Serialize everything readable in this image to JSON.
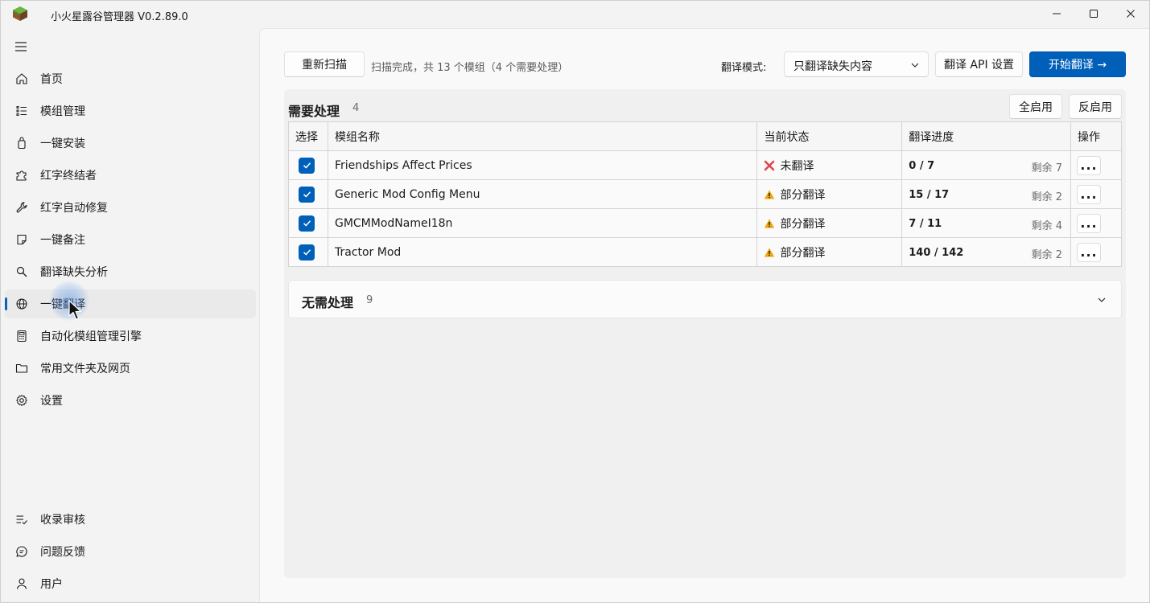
{
  "app": {
    "title": "小火星露谷管理器 V0.2.89.0"
  },
  "sidebar": {
    "items": [
      {
        "label": "首页",
        "icon": "home-icon"
      },
      {
        "label": "模组管理",
        "icon": "list-icon"
      },
      {
        "label": "一键安装",
        "icon": "package-icon"
      },
      {
        "label": "红字终结者",
        "icon": "puzzle-icon"
      },
      {
        "label": "红字自动修复",
        "icon": "wrench-icon"
      },
      {
        "label": "一键备注",
        "icon": "note-icon"
      },
      {
        "label": "翻译缺失分析",
        "icon": "search-icon"
      },
      {
        "label": "一键翻译",
        "icon": "globe-icon",
        "active": true
      },
      {
        "label": "自动化模组管理引擎",
        "icon": "calculator-icon"
      },
      {
        "label": "常用文件夹及网页",
        "icon": "folder-icon"
      },
      {
        "label": "设置",
        "icon": "gear-icon"
      }
    ],
    "bottom_items": [
      {
        "label": "收录审核",
        "icon": "list-check-icon"
      },
      {
        "label": "问题反馈",
        "icon": "chat-icon"
      },
      {
        "label": "用户",
        "icon": "user-icon"
      }
    ]
  },
  "toolbar": {
    "rescan_label": "重新扫描",
    "scan_status": "扫描完成，共 13 个模组（4 个需要处理）",
    "mode_label": "翻译模式:",
    "mode_value": "只翻译缺失内容",
    "api_settings_label": "翻译 API 设置",
    "start_label": "开始翻译 →"
  },
  "needs": {
    "title": "需要处理",
    "count": "4",
    "enable_all_label": "全启用",
    "invert_label": "反启用",
    "columns": [
      "选择",
      "模组名称",
      "当前状态",
      "翻译进度",
      "操作"
    ],
    "rows": [
      {
        "checked": true,
        "name": "Friendships Affect Prices",
        "status": "未翻译",
        "status_type": "error",
        "progress": "0 / 7",
        "remaining": "剩余 7"
      },
      {
        "checked": true,
        "name": "Generic Mod Config Menu",
        "status": "部分翻译",
        "status_type": "warning",
        "progress": "15 / 17",
        "remaining": "剩余 2"
      },
      {
        "checked": true,
        "name": "GMCMModNameI18n",
        "status": "部分翻译",
        "status_type": "warning",
        "progress": "7 / 11",
        "remaining": "剩余 4"
      },
      {
        "checked": true,
        "name": "Tractor Mod",
        "status": "部分翻译",
        "status_type": "warning",
        "progress": "140 / 142",
        "remaining": "剩余 2"
      }
    ],
    "more_label": "..."
  },
  "no_need": {
    "title": "无需处理",
    "count": "9"
  },
  "colors": {
    "accent": "#005fb8",
    "error": "#e0474e",
    "warning": "#f0a30a"
  }
}
